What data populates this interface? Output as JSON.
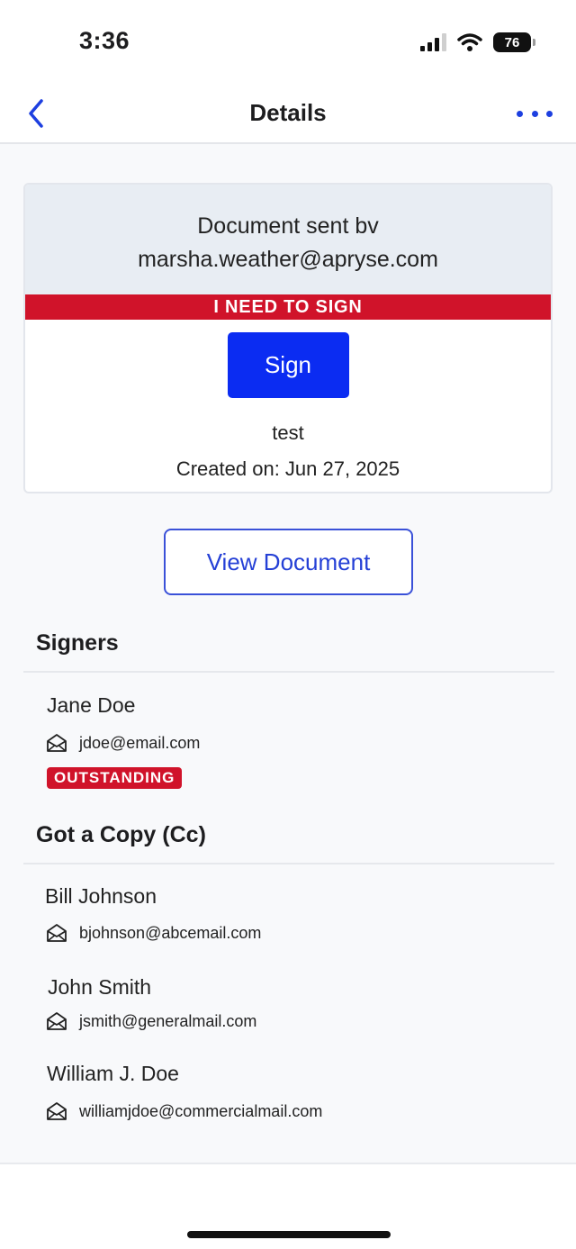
{
  "status_bar": {
    "time": "3:36",
    "battery_level": "76"
  },
  "nav": {
    "title": "Details",
    "back_icon": "chevron-left-icon",
    "more_icon": "ellipsis-icon"
  },
  "document_card": {
    "sent_by_label": "Document sent bv",
    "sender_email": "marsha.weather@apryse.com",
    "status_banner": "I NEED TO SIGN",
    "sign_button": "Sign",
    "document_name": "test",
    "created_on": "Created on: Jun 27, 2025"
  },
  "view_document_button": "View Document",
  "signers": {
    "title": "Signers",
    "items": [
      {
        "name": "Jane Doe",
        "email": "jdoe@email.com",
        "status": "OUTSTANDING"
      }
    ]
  },
  "cc": {
    "title": "Got a Copy (Cc)",
    "items": [
      {
        "name": "Bill Johnson",
        "email": "bjohnson@abcemail.com"
      },
      {
        "name": "John Smith",
        "email": "jsmith@generalmail.com"
      },
      {
        "name": "William J. Doe",
        "email": "williamjdoe@commercialmail.com"
      }
    ]
  },
  "colors": {
    "accent": "#0b2cf2",
    "danger": "#d0132a",
    "link": "#2540d6"
  }
}
